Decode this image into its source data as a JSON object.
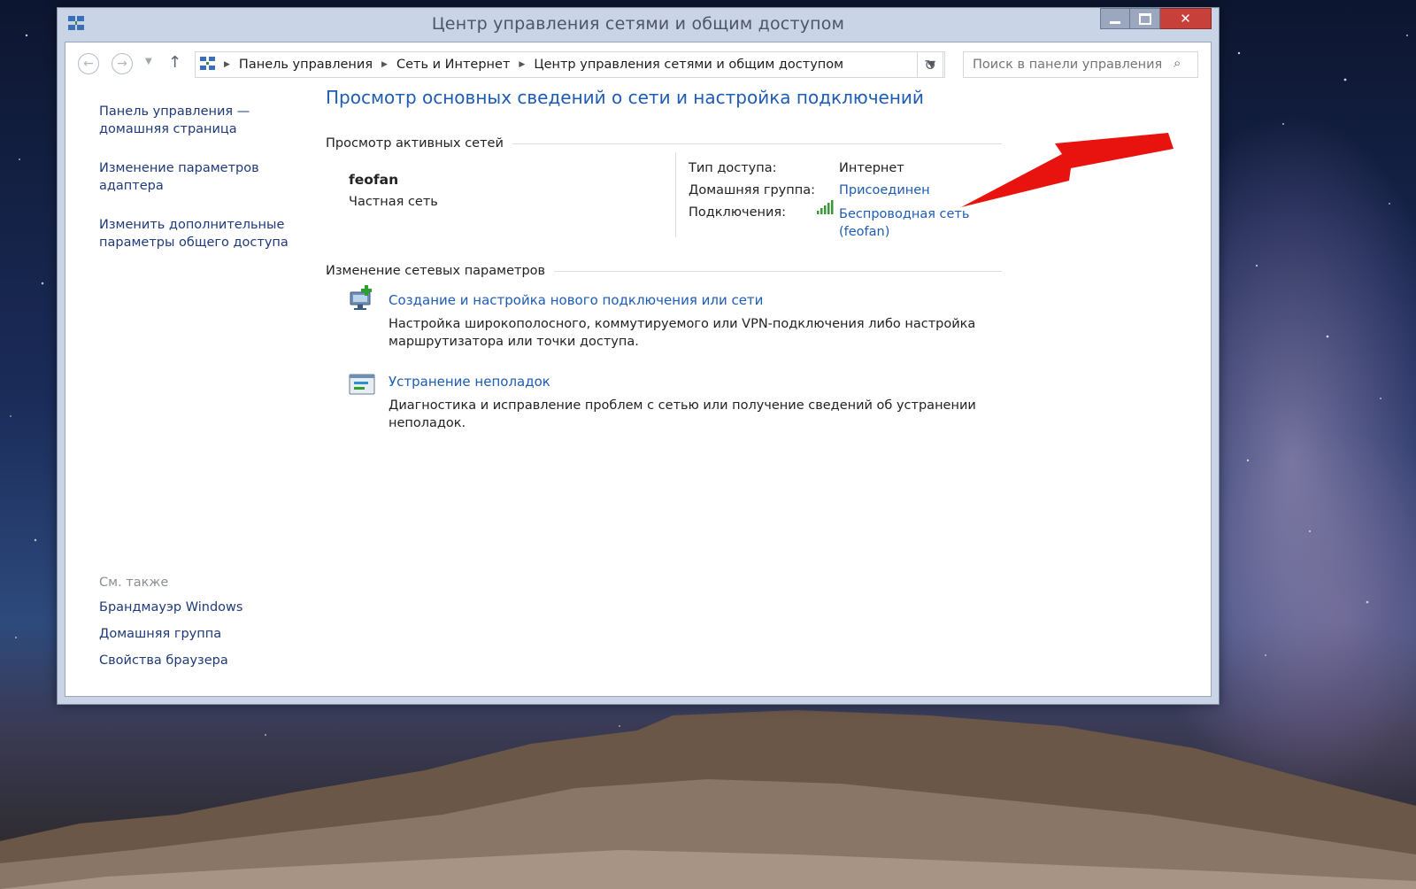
{
  "window": {
    "title": "Центр управления сетями и общим доступом",
    "close_glyph": "✕"
  },
  "nav": {
    "breadcrumbs": [
      "Панель управления",
      "Сеть и Интернет",
      "Центр управления сетями и общим доступом"
    ],
    "search_placeholder": "Поиск в панели управления"
  },
  "left_pane": {
    "links": [
      "Панель управления — домашняя страница",
      "Изменение параметров адаптера",
      "Изменить дополнительные параметры общего доступа"
    ],
    "see_also_header": "См. также",
    "see_also": [
      "Брандмауэр Windows",
      "Домашняя группа",
      "Свойства браузера"
    ]
  },
  "main": {
    "title": "Просмотр основных сведений о сети и настройка подключений",
    "active_networks_header": "Просмотр активных сетей",
    "network": {
      "name": "feofan",
      "type": "Частная сеть",
      "access_type_label": "Тип доступа:",
      "access_type_value": "Интернет",
      "homegroup_label": "Домашняя группа:",
      "homegroup_value": "Присоединен",
      "connections_label": "Подключения:",
      "connection_line1": "Беспроводная сеть",
      "connection_line2": "(feofan)"
    },
    "change_settings_header": "Изменение сетевых параметров",
    "tasks": [
      {
        "title": "Создание и настройка нового подключения или сети",
        "description": "Настройка широкополосного, коммутируемого или VPN-подключения либо настройка маршрутизатора или точки доступа."
      },
      {
        "title": "Устранение неполадок",
        "description": "Диагностика и исправление проблем с сетью или получение сведений об устранении неполадок."
      }
    ]
  },
  "colors": {
    "link": "#1e5cb3",
    "nav_link": "#1e3a78",
    "close_button": "#c7403a",
    "annotation_arrow": "#e8130f"
  }
}
